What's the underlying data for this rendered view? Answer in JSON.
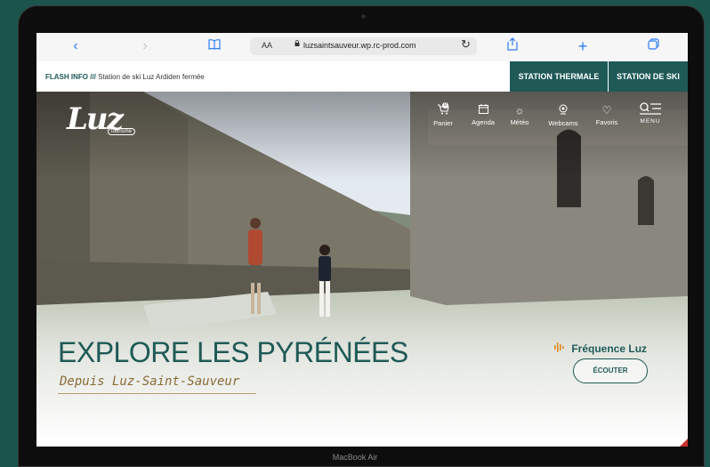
{
  "device": {
    "label": "MacBook Air"
  },
  "browser": {
    "back_icon": "‹",
    "forward_icon": "›",
    "bookmarks_icon": "📖",
    "aa": "AA",
    "url": "luzsaintsauveur.wp.rc-prod.com",
    "reload_icon": "↻",
    "share_icon": "⇪",
    "new_tab_icon": "+",
    "tabs_icon": "⧉"
  },
  "flash": {
    "title": "FLASH INFO ///",
    "message": "Station de ski Luz Ardiden fermée"
  },
  "stations": [
    "STATION THERMALE",
    "STATION DE SKI"
  ],
  "logo": {
    "text": "Luz",
    "tag": "tourisme"
  },
  "nav": {
    "items": [
      {
        "label": "Panier",
        "icon": "cart-icon",
        "badge": "0"
      },
      {
        "label": "Agenda",
        "icon": "calendar-icon"
      },
      {
        "label": "Météo",
        "icon": "sun-icon"
      },
      {
        "label": "Webcams",
        "icon": "webcam-icon"
      },
      {
        "label": "Favoris",
        "icon": "heart-icon"
      }
    ],
    "menu": "MENU"
  },
  "hero": {
    "headline": "EXPLORE LES PYRÉNÉES",
    "subline": "Depuis Luz-Saint-Sauveur",
    "radio_title": "Fréquence Luz",
    "listen_button": "ÉCOUTER"
  },
  "colors": {
    "brand": "#1f5a57",
    "accent": "#e08a1e",
    "gold": "#8a6a35",
    "background": "#1b544c"
  }
}
